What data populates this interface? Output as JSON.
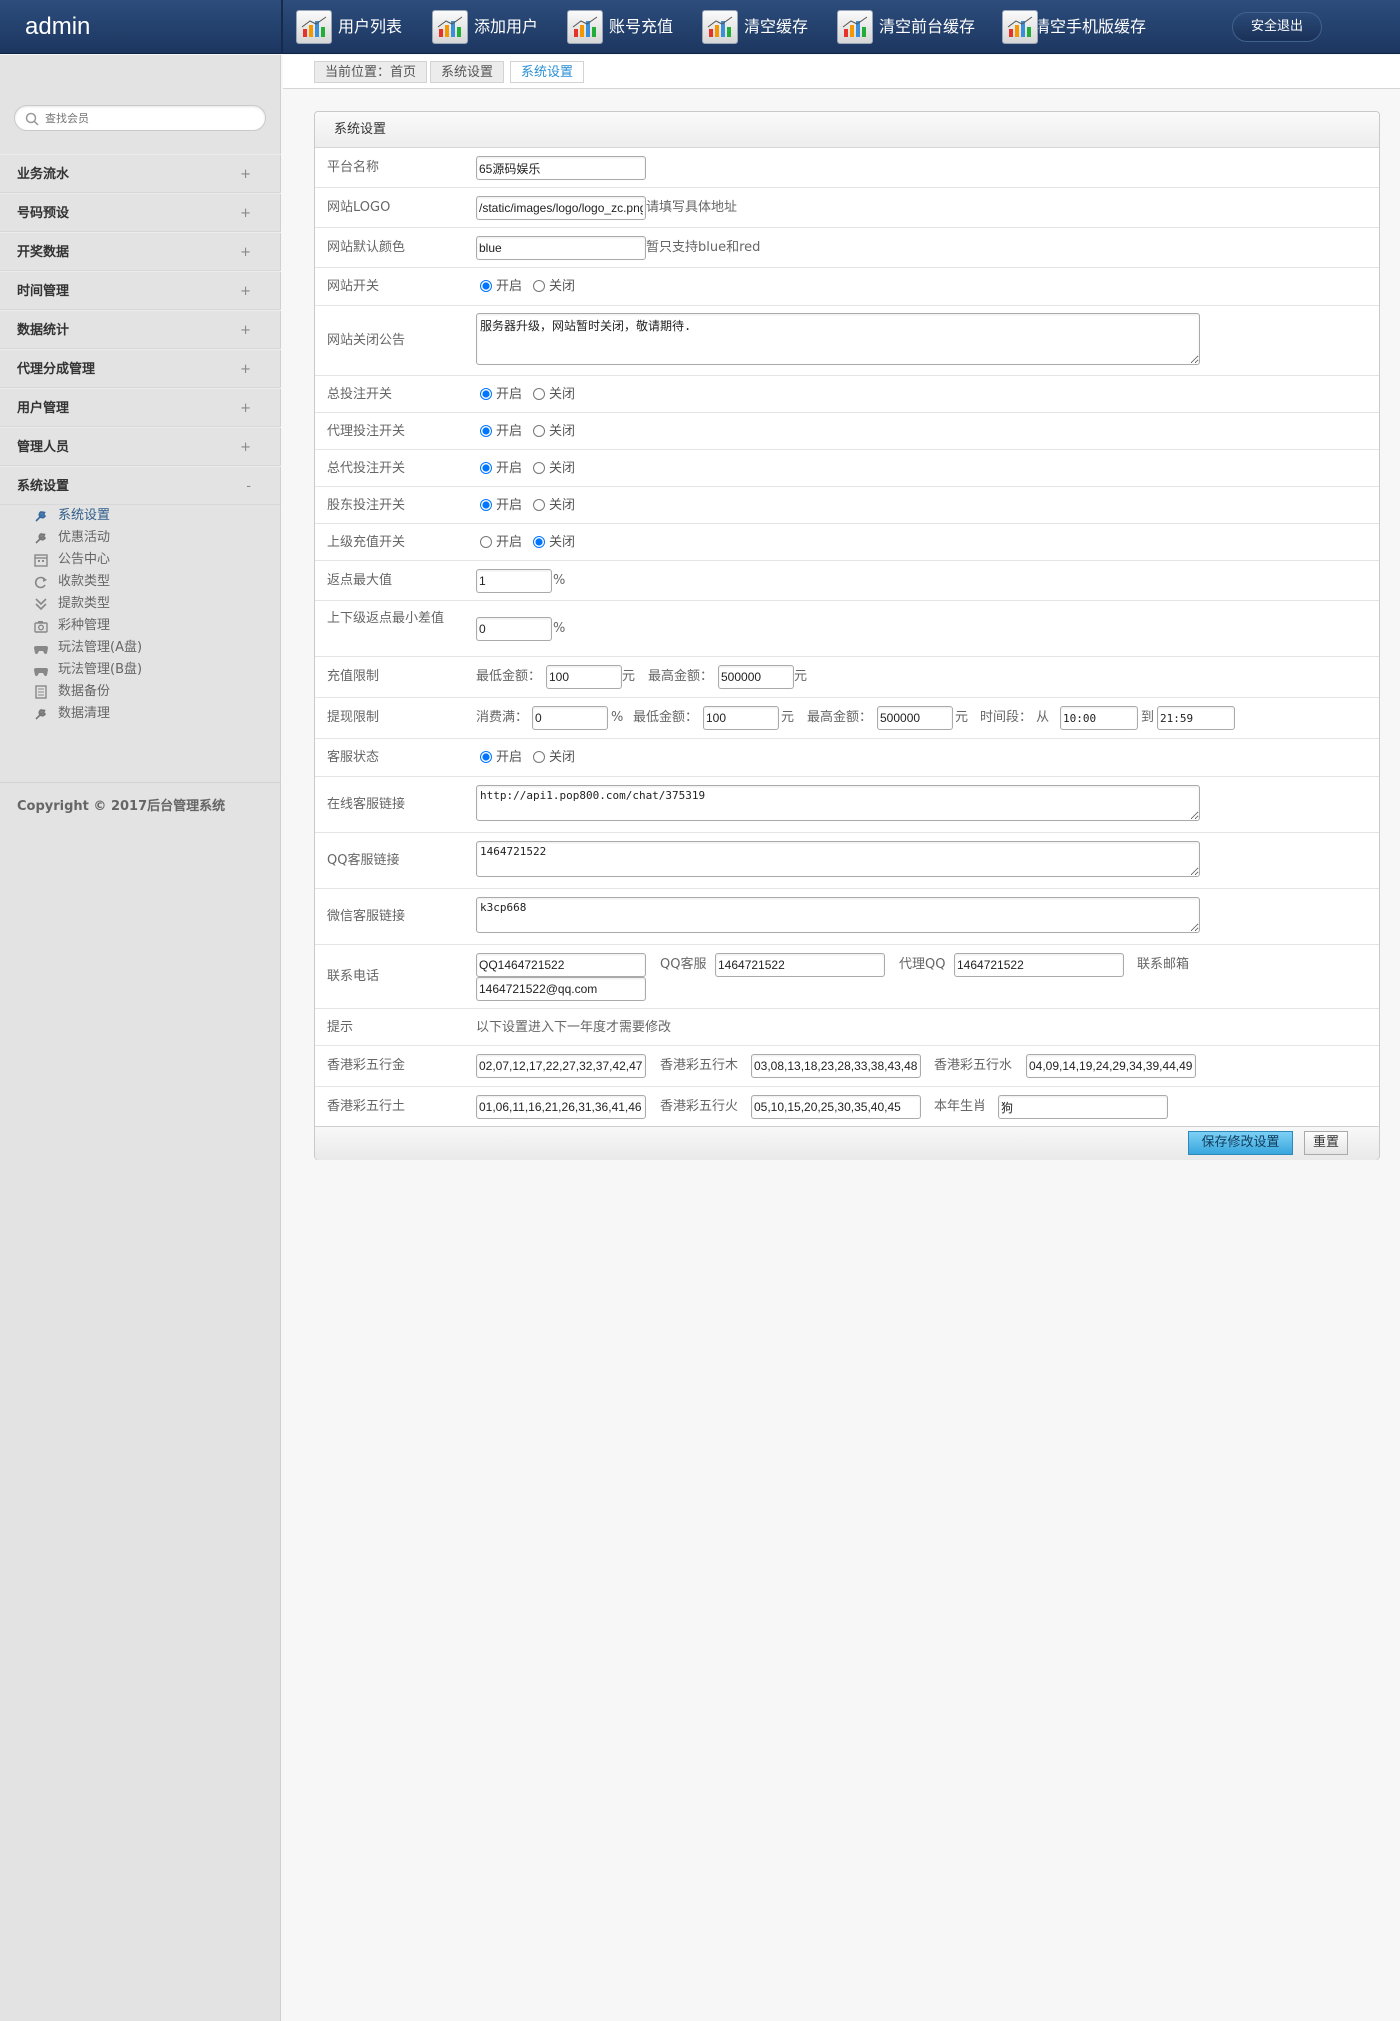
{
  "topbar": {
    "brand": "admin",
    "nav": [
      {
        "label": "用户列表"
      },
      {
        "label": "添加用户"
      },
      {
        "label": "账号充值"
      },
      {
        "label": "清空缓存"
      },
      {
        "label": "清空前台缓存"
      },
      {
        "label": "清空手机版缓存"
      }
    ],
    "logout_label": "安全退出"
  },
  "sidebar": {
    "search_placeholder": "查找会员",
    "groups": [
      {
        "label": "业务流水",
        "toggle": "+"
      },
      {
        "label": "号码预设",
        "toggle": "+"
      },
      {
        "label": "开奖数据",
        "toggle": "+"
      },
      {
        "label": "时间管理",
        "toggle": "+"
      },
      {
        "label": "数据统计",
        "toggle": "+"
      },
      {
        "label": "代理分成管理",
        "toggle": "+"
      },
      {
        "label": "用户管理",
        "toggle": "+"
      },
      {
        "label": "管理人员",
        "toggle": "+"
      },
      {
        "label": "系统设置",
        "toggle": "-"
      }
    ],
    "subitems": [
      {
        "label": "系统设置",
        "icon": "wrench-icon"
      },
      {
        "label": "优惠活动",
        "icon": "wrench-icon"
      },
      {
        "label": "公告中心",
        "icon": "calendar-icon"
      },
      {
        "label": "收款类型",
        "icon": "cycle-icon"
      },
      {
        "label": "提款类型",
        "icon": "download-icon"
      },
      {
        "label": "彩种管理",
        "icon": "camera-icon"
      },
      {
        "label": "玩法管理(A盘)",
        "icon": "gamepad-icon"
      },
      {
        "label": "玩法管理(B盘)",
        "icon": "gamepad-icon"
      },
      {
        "label": "数据备份",
        "icon": "document-icon"
      },
      {
        "label": "数据清理",
        "icon": "wrench-icon"
      }
    ],
    "copyright": "Copyright © 2017后台管理系统"
  },
  "breadcrumb": {
    "items": [
      "当前位置：首页",
      "系统设置",
      "系统设置"
    ]
  },
  "panel": {
    "title": "系统设置",
    "radio_on": "开启",
    "radio_off": "关闭",
    "fields": {
      "platform_name": {
        "label": "平台名称",
        "value": "65源码娱乐"
      },
      "logo": {
        "label": "网站LOGO",
        "value": "/static/images/logo/logo_zc.png",
        "hint": "请填写具体地址"
      },
      "color": {
        "label": "网站默认颜色",
        "value": "blue",
        "hint": "暂只支持blue和red"
      },
      "site_switch": {
        "label": "网站开关",
        "selected": "开启"
      },
      "close_notice": {
        "label": "网站关闭公告",
        "value": "服务器升级，网站暂时关闭，敬请期待."
      },
      "bet_switch": {
        "label": "总投注开关",
        "selected": "开启"
      },
      "agent_bet_switch": {
        "label": "代理投注开关",
        "selected": "开启"
      },
      "general_agent_bet_switch": {
        "label": "总代投注开关",
        "selected": "开启"
      },
      "shareholder_bet_switch": {
        "label": "股东投注开关",
        "selected": "开启"
      },
      "parent_recharge_switch": {
        "label": "上级充值开关",
        "selected": "关闭"
      },
      "rebate_max": {
        "label": "返点最大值",
        "value": "1",
        "unit": "%"
      },
      "rebate_min_diff": {
        "label": "上下级返点最小差值",
        "value": "0",
        "unit": "%"
      },
      "recharge_limit": {
        "label": "充值限制",
        "min_label": "最低金额：",
        "min_value": "100",
        "min_unit": "元",
        "max_label": "最高金额：",
        "max_value": "500000",
        "max_unit": "元"
      },
      "withdraw_limit": {
        "label": "提现限制",
        "consume_label": "消费满：",
        "consume_value": "0",
        "consume_unit": "%",
        "min_label": "最低金额：",
        "min_value": "100",
        "min_unit": "元",
        "max_label": "最高金额：",
        "max_value": "500000",
        "max_unit": "元",
        "time_label": "时间段： 从",
        "time_from": "10:00",
        "time_to_label": "到",
        "time_to": "21:59"
      },
      "service_status": {
        "label": "客服状态",
        "selected": "开启"
      },
      "online_service": {
        "label": "在线客服链接",
        "value": "http://api1.pop800.com/chat/375319"
      },
      "qq_service": {
        "label": "QQ客服链接",
        "value": "1464721522"
      },
      "wechat_service": {
        "label": "微信客服链接",
        "value": "k3cp668"
      },
      "contact": {
        "label": "联系电话",
        "phone_value": "QQ1464721522",
        "qq_label": "QQ客服",
        "qq_value": "1464721522",
        "agent_qq_label": "代理QQ",
        "agent_qq_value": "1464721522",
        "email_label": "联系邮箱",
        "email_value": "1464721522@qq.com"
      },
      "tip": {
        "label": "提示",
        "text": "以下设置进入下一年度才需要修改"
      },
      "hk_gold": {
        "label": "香港彩五行金",
        "value": "02,07,12,17,22,27,32,37,42,47"
      },
      "hk_wood": {
        "label": "香港彩五行木",
        "value": "03,08,13,18,23,28,33,38,43,48"
      },
      "hk_water": {
        "label": "香港彩五行水",
        "value": "04,09,14,19,24,29,34,39,44,49"
      },
      "hk_earth": {
        "label": "香港彩五行土",
        "value": "01,06,11,16,21,26,31,36,41,46"
      },
      "hk_fire": {
        "label": "香港彩五行火",
        "value": "05,10,15,20,25,30,35,40,45"
      },
      "zodiac": {
        "label": "本年生肖",
        "value": "狗"
      }
    },
    "save_label": "保存修改设置",
    "reset_label": "重置"
  }
}
